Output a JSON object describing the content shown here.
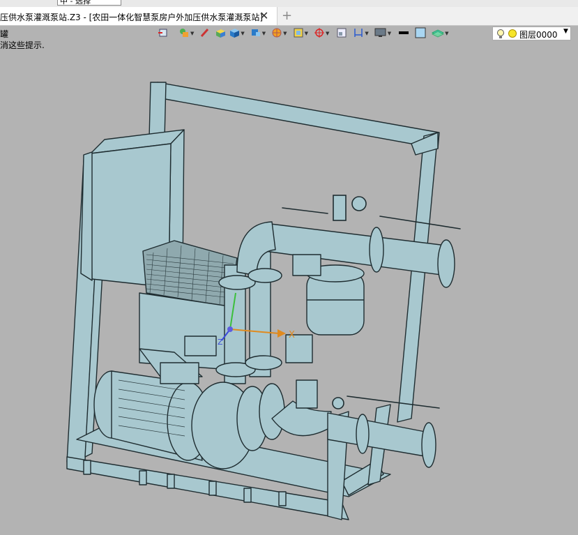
{
  "top_strip": {
    "combo_value": "中 - 选择"
  },
  "tab": {
    "title": "压供水泵灌溉泵站.Z3 - [农田一体化智慧泵房户外加压供水泵灌溉泵站]",
    "close": "✕",
    "new": "+"
  },
  "hints": {
    "line1": "罐",
    "line2": "消这些提示."
  },
  "toolbar": [
    {
      "name": "exit-sketch-icon"
    },
    {
      "name": "history-shape-icon"
    },
    {
      "name": "pen-marker-icon"
    },
    {
      "name": "shaded-box-icon"
    },
    {
      "name": "blue-cube-icon"
    },
    {
      "name": "view-cube-icon"
    },
    {
      "name": "render-wheel-icon"
    },
    {
      "name": "display-mode-icon"
    },
    {
      "name": "axis-filter-icon"
    },
    {
      "name": "sheet-window-icon"
    },
    {
      "name": "dimension-icon"
    },
    {
      "name": "monitor-icon"
    },
    {
      "name": "line-style-icon"
    },
    {
      "name": "color-square-icon"
    },
    {
      "name": "layer-stack-icon"
    }
  ],
  "layer": {
    "label": "图层0000"
  },
  "triad": {
    "x": "X",
    "y": "Y",
    "z": "Z"
  },
  "colors": {
    "model_fill": "#a8c8cf",
    "model_stroke": "#1e2c30",
    "background": "#b3b3b3",
    "axis_x": "#e08a1e",
    "axis_y": "#3bbf3b",
    "axis_z": "#3b4bd9"
  }
}
